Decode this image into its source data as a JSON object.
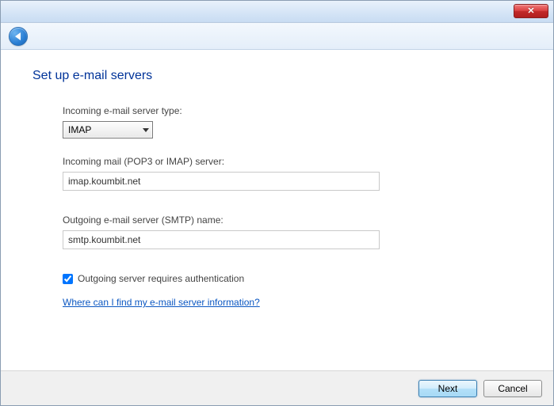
{
  "page": {
    "title": "Set up e-mail servers"
  },
  "incoming": {
    "type_label": "Incoming e-mail server type:",
    "type_value": "IMAP",
    "server_label": "Incoming mail (POP3 or IMAP) server:",
    "server_value": "imap.koumbit.net"
  },
  "outgoing": {
    "server_label": "Outgoing e-mail server (SMTP) name:",
    "server_value": "smtp.koumbit.net",
    "auth_label": "Outgoing server requires authentication",
    "auth_checked": true
  },
  "help": {
    "link_text": "Where can I find my e-mail server information?"
  },
  "buttons": {
    "next": "Next",
    "cancel": "Cancel"
  }
}
